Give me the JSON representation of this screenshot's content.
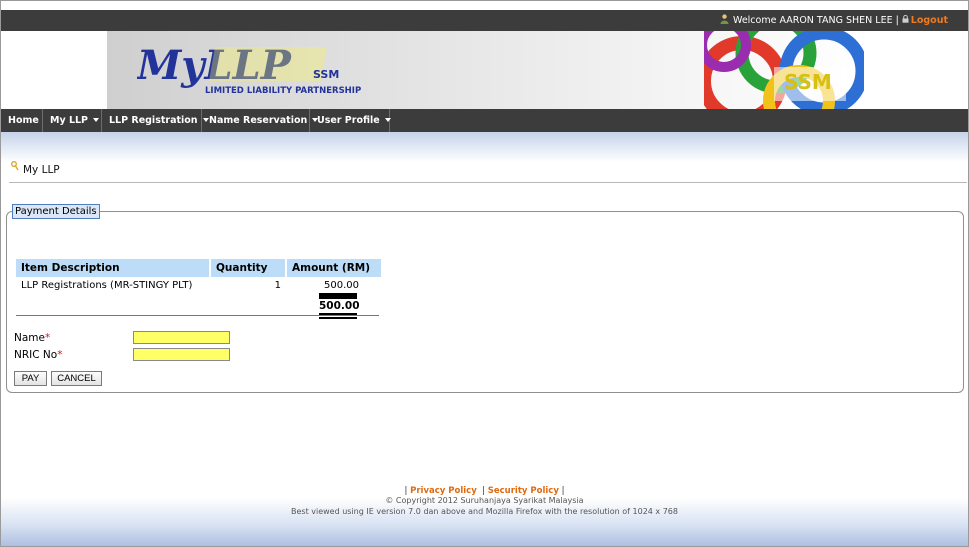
{
  "header": {
    "welcome_text": "Welcome AARON TANG SHEN LEE",
    "separator": "|",
    "logout_label": "Logout"
  },
  "banner": {
    "logo_text": "MyLLP",
    "logo_tagline": "LIMITED LIABILITY PARTNERSHIP",
    "ssm_text": "SSM"
  },
  "nav": {
    "items": [
      {
        "label": "Home"
      },
      {
        "label": "My LLP"
      },
      {
        "label": "LLP Registration"
      },
      {
        "label": "Name Reservation"
      },
      {
        "label": "User Profile"
      }
    ]
  },
  "breadcrumb": {
    "label": "My LLP"
  },
  "payment": {
    "legend": "Payment Details",
    "columns": [
      "Item Description",
      "Quantity",
      "Amount (RM)"
    ],
    "rows": [
      {
        "description": "LLP Registrations (MR-STINGY PLT)",
        "quantity": "1",
        "amount": "500.00"
      }
    ],
    "total": "500.00"
  },
  "form": {
    "name_label": "Name",
    "nric_label": "NRIC No",
    "required_mark": "*",
    "name_value": "",
    "nric_value": "",
    "pay_label": "PAY",
    "cancel_label": "CANCEL"
  },
  "footer": {
    "privacy_label": "Privacy Policy",
    "security_label": "Security Policy",
    "copyright": "© Copyright 2012 Suruhanjaya Syarikat Malaysia",
    "best_viewed": "Best viewed using IE version 7.0 dan above and Mozilla Firefox with the resolution of 1024 x 768"
  },
  "colors": {
    "bar": "#3c3c3c",
    "accent_orange": "#f07a1e",
    "header_cell": "#bcdcf7",
    "input_fill": "#ffff66",
    "required": "#d01b1b"
  }
}
